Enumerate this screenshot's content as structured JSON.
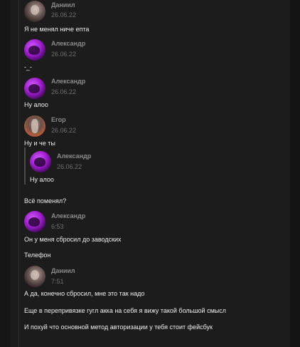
{
  "messages": [
    {
      "author": "Даниил",
      "time": "26.06.22",
      "text": "Я не менял ниче епта",
      "avatar": "daniil-avatar"
    },
    {
      "author": "Александр",
      "time": "26.06.22",
      "text": "-_-",
      "avatar": "alexandr-avatar"
    },
    {
      "author": "Александр",
      "time": "26.06.22",
      "text": "Ну алоо",
      "avatar": "alexandr-avatar"
    },
    {
      "author": "Егор",
      "time": "26.06.22",
      "text": "Ну и че ты",
      "avatar": "egor-avatar"
    },
    {
      "author": "Александр",
      "time": "26.06.22",
      "text": "Ну алоо",
      "avatar": "alexandr-avatar",
      "quoted": true
    },
    {
      "author": "",
      "time": "",
      "text": "Всё поменял?"
    },
    {
      "author": "Александр",
      "time": "6:53",
      "text": "Он у меня сбросил до заводских",
      "avatar": "alexandr-avatar"
    },
    {
      "author": "",
      "time": "",
      "text": "Телефон"
    },
    {
      "author": "Даниил",
      "time": "7:51",
      "text": "А да, конечно сбросил, мне это так надо",
      "avatar": "daniil-avatar"
    },
    {
      "author": "",
      "time": "",
      "text": "Еще в перепривязке гугл акка на себя я вижу такой большой смысл"
    },
    {
      "author": "",
      "time": "",
      "text": "И похуй что основной метод авторизации у тебя стоит фейсбук"
    }
  ],
  "colors": {
    "background": "#161616",
    "panel": "#1c1c1c",
    "author": "#8a8a8a",
    "time": "#6e6e6e",
    "text": "#ededed"
  }
}
